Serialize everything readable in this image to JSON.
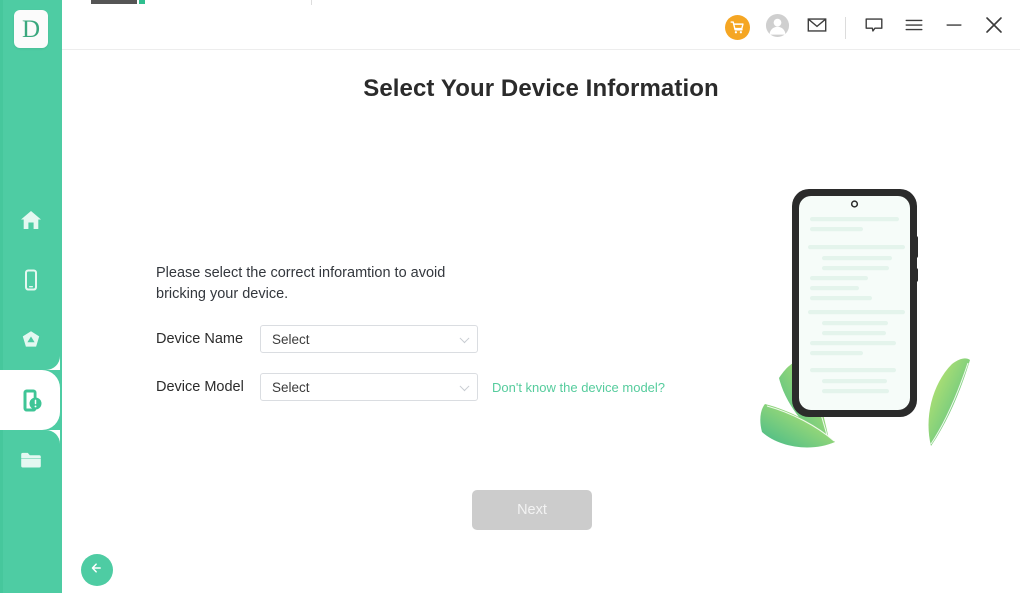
{
  "app": {
    "logo_letter": "D",
    "accent_color": "#4ecca3",
    "cart_color": "#f5a623",
    "link_color": "#56cc9d",
    "title_color": "#2b2b2b"
  },
  "sidebar": {
    "items": [
      {
        "name": "home",
        "icon": "home-icon",
        "active": false
      },
      {
        "name": "phone",
        "icon": "phone-icon",
        "active": false
      },
      {
        "name": "cloud-backup",
        "icon": "cloud-pentagon-icon",
        "active": false
      },
      {
        "name": "system-repair",
        "icon": "phone-alert-icon",
        "active": true
      },
      {
        "name": "files",
        "icon": "folder-icon",
        "active": false
      }
    ]
  },
  "titlebar": {
    "buttons": [
      {
        "name": "cart",
        "icon": "shopping-cart-icon"
      },
      {
        "name": "account",
        "icon": "user-avatar-icon"
      },
      {
        "name": "mail",
        "icon": "envelope-icon"
      },
      {
        "name": "feedback",
        "icon": "speech-bubble-icon"
      },
      {
        "name": "menu",
        "icon": "hamburger-menu-icon"
      },
      {
        "name": "minimize",
        "icon": "minimize-icon"
      },
      {
        "name": "close",
        "icon": "close-icon"
      }
    ]
  },
  "main": {
    "page_title": "Select Your Device Information",
    "description": "Please select the correct inforamtion to avoid bricking your device.",
    "fields": [
      {
        "label": "Device Name",
        "value": "Select",
        "placeholder": "Select"
      },
      {
        "label": "Device Model",
        "value": "Select",
        "placeholder": "Select"
      }
    ],
    "help_link": "Don't know the device model?",
    "next_label": "Next",
    "back_icon": "arrow-left-icon"
  },
  "illustration": {
    "name": "phone-with-document-lines",
    "screen_line_color": "#e4f4ec",
    "screen_bg": "#f6fcf9",
    "frame_color": "#2b2b2b",
    "leaf_gradient_from": "#c9e96d",
    "leaf_gradient_to": "#41b98a"
  }
}
